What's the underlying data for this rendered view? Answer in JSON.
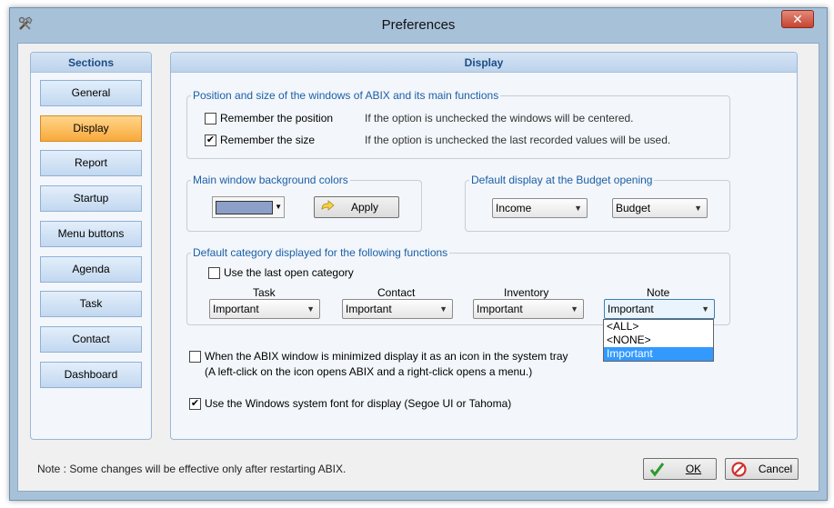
{
  "window": {
    "title": "Preferences",
    "close_label": "✕"
  },
  "sections": {
    "header": "Sections",
    "items": [
      "General",
      "Display",
      "Report",
      "Startup",
      "Menu buttons",
      "Agenda",
      "Task",
      "Contact",
      "Dashboard"
    ],
    "active": "Display"
  },
  "panel": {
    "header": "Display"
  },
  "position_group": {
    "label": "Position and size of the windows of ABIX and its main functions",
    "remember_position": {
      "label": "Remember the position",
      "checked": false,
      "hint": "If the option is unchecked the windows will be centered."
    },
    "remember_size": {
      "label": "Remember the size",
      "checked": true,
      "hint": "If the option is unchecked the last recorded values will be used."
    }
  },
  "bg_group": {
    "label": "Main window background colors",
    "apply_label": "Apply",
    "swatch_color": "#8c9fc7"
  },
  "budget_group": {
    "label": "Default display at the Budget opening",
    "combo1": "Income",
    "combo2": "Budget"
  },
  "category_group": {
    "label": "Default category displayed for the following functions",
    "use_last": {
      "label": "Use the last open category",
      "checked": false
    },
    "columns": [
      {
        "header": "Task",
        "value": "Important"
      },
      {
        "header": "Contact",
        "value": "Important"
      },
      {
        "header": "Inventory",
        "value": "Important"
      },
      {
        "header": "Note",
        "value": "Important"
      }
    ],
    "dropdown_options": [
      "<ALL>",
      "<NONE>",
      "Important"
    ],
    "dropdown_selected": "Important"
  },
  "tray_option": {
    "checked": false,
    "line1": "When the ABIX window is minimized display it as an icon in the system tray",
    "line2": "(A left-click on the icon opens ABIX and a right-click opens a menu.)"
  },
  "font_option": {
    "checked": true,
    "label": "Use the Windows system font for display (Segoe UI or Tahoma)"
  },
  "footer": {
    "note": "Note : Some changes will be effective only after restarting ABIX.",
    "ok_label": "OK",
    "cancel_label": "Cancel"
  },
  "colors": {
    "accent": "#1a5fa8",
    "active_tab": "#f8a93c",
    "selection": "#3399ff"
  }
}
